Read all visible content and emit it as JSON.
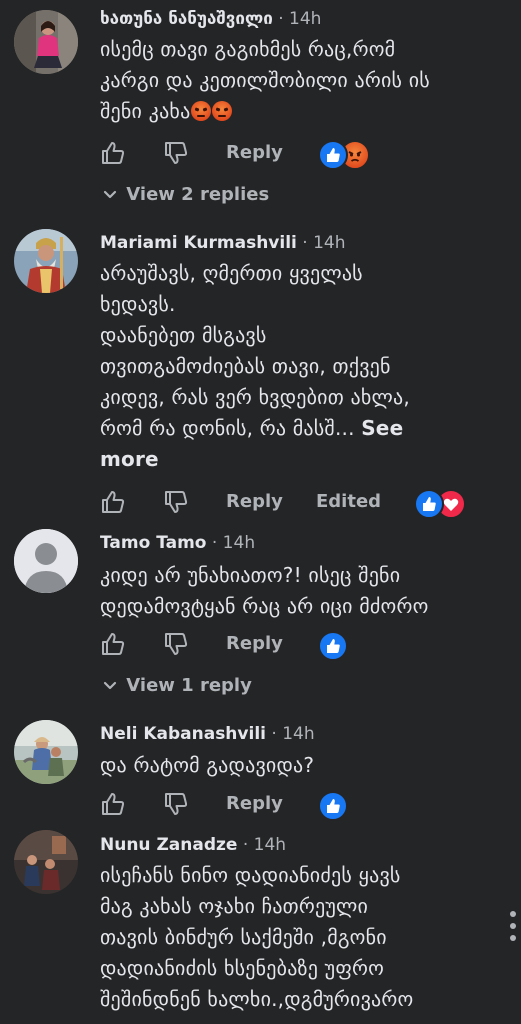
{
  "comments": [
    {
      "author": "ხათუნა ნანუაშვილი",
      "time": "· 14h",
      "lines": [
        "ისემც თავი გაგიხმეს რაც,რომ",
        "კარგი და კეთილშობილი არის ის",
        "შენი კახა"
      ],
      "reply_label": "Reply",
      "reactions": [
        "like",
        "angry"
      ],
      "view_replies": "View 2 replies"
    },
    {
      "author": "Mariami Kurmashvili",
      "time": "· 14h",
      "lines": [
        "არაუშავს, ღმერთი ყველას",
        "ხედავს.",
        "დაანებეთ მსგავს",
        "თვითგამოძიებას თავი, თქვენ",
        "კიდევ, რას ვერ ხვდებით ახლა,",
        "რომ რა დონის, რა მასშ..."
      ],
      "see_more": "See more",
      "see_more_part1": "See",
      "see_more_part2": "more",
      "reply_label": "Reply",
      "edited_label": "Edited",
      "reactions": [
        "like",
        "love"
      ]
    },
    {
      "author": "Tamo Tamo",
      "time": "· 14h",
      "lines": [
        "კიდე არ უნახიათო?! ისეც შენი",
        "დედამოვტყან რაც არ იცი მძორო"
      ],
      "reply_label": "Reply",
      "reactions": [
        "like"
      ],
      "view_replies": "View 1 reply"
    },
    {
      "author": "Neli Kabanashvili",
      "time": "· 14h",
      "lines": [
        "და რატომ გადავიდა?"
      ],
      "reply_label": "Reply",
      "reactions": [
        "like"
      ]
    },
    {
      "author": "Nunu Zanadze",
      "time": "· 14h",
      "lines": [
        "ისეჩანს ნინო დადიანიძეს ყავს",
        "მაგ კახას ოჯახი ჩათრეული",
        "თავის ბინძურ საქმეში ,მგონი",
        "დადიანიძის ხსენებაზე უფრო",
        "შეშინდნენ ხალხი.,დგმურივარო"
      ]
    }
  ],
  "colors": {
    "background": "#242526",
    "text_primary": "#e4e6eb",
    "text_secondary": "#b0b3b8",
    "like_blue": "#1877f2",
    "love_red": "#f02849",
    "angry_orange": "#e24a1e"
  },
  "icons": {
    "like": "thumbs-up-icon",
    "dislike": "thumbs-down-icon",
    "more": "more-options-icon",
    "chevron": "chevron-down-icon"
  }
}
